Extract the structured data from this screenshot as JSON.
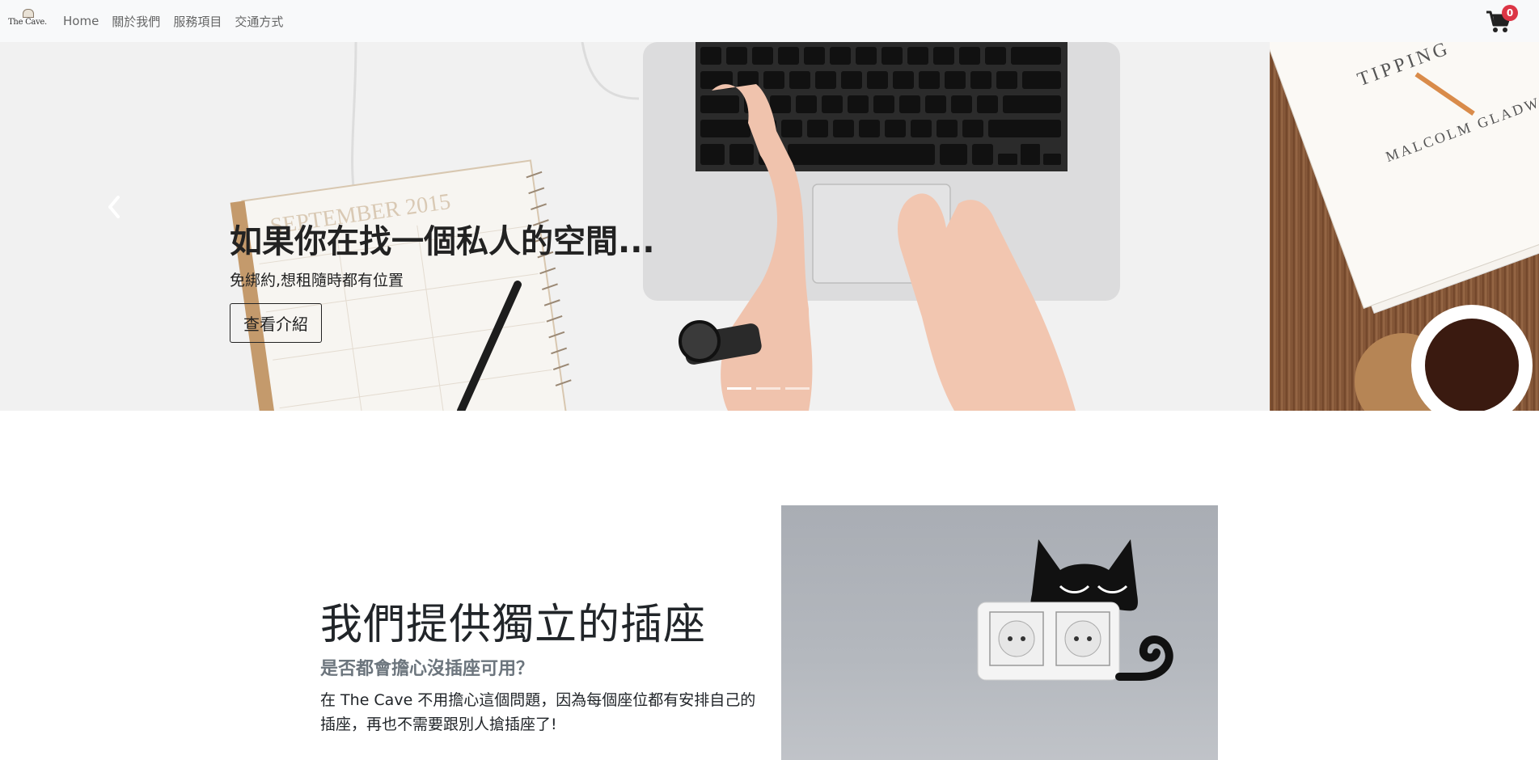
{
  "navbar": {
    "brand_text": "The Cave.",
    "links": [
      "Home",
      "關於我們",
      "服務項目",
      "交通方式"
    ],
    "cart_count": "0"
  },
  "hero": {
    "title": "如果你在找一個私人的空間...",
    "subtitle": "免綁約,想租隨時都有位置",
    "button_label": "查看介紹",
    "slide_count": 3,
    "active_slide": 1,
    "photo_text": {
      "planner_month": "SEPTEMBER 2015",
      "book_title": "TIPPING",
      "book_author": "MALCOLM GLADWELL"
    }
  },
  "feature": {
    "title": "我們提供獨立的插座",
    "lead": "是否都會擔心沒插座可用？",
    "description": "在 The Cave 不用擔心這個問題，因為每個座位都有安排自己的插座，再也不需要跟別人搶插座了!"
  },
  "colors": {
    "navbar_bg": "#f8f9fa",
    "badge_red": "#dc3545",
    "lead_gray": "#6c757d"
  },
  "icons": [
    "cart-icon",
    "chevron-left-icon"
  ]
}
